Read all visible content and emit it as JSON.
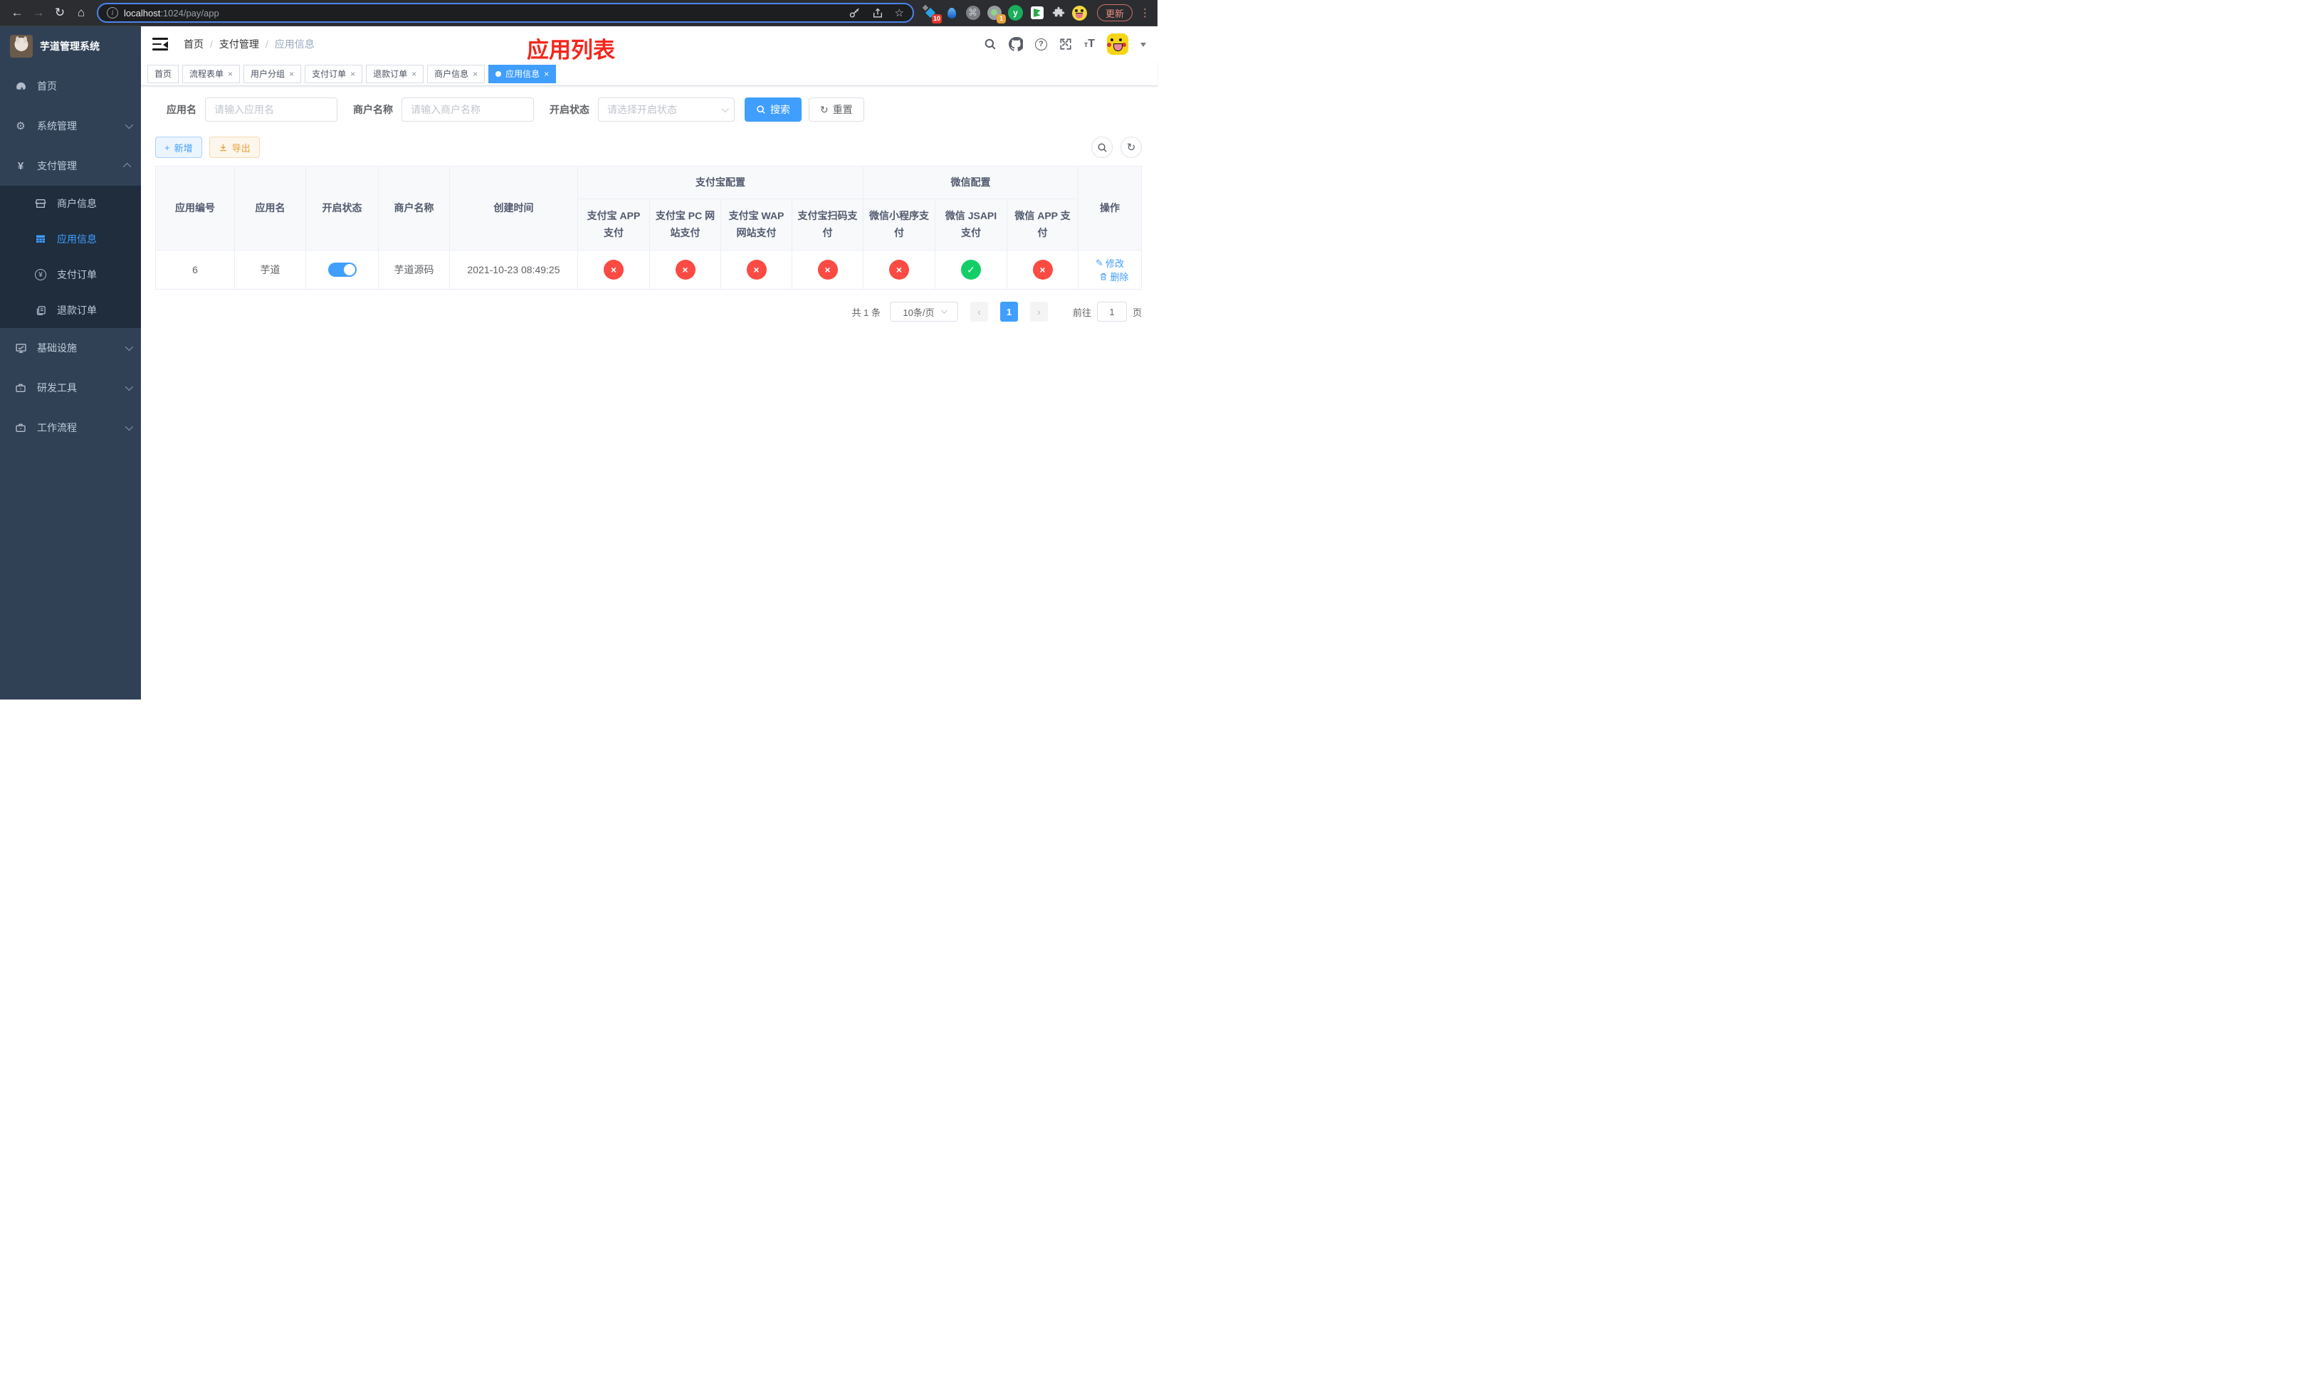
{
  "colors": {
    "accent": "#409eff",
    "danger": "#fb4b43",
    "success": "#13ce66",
    "warning": "#e6a23c",
    "annotation_red": "#f5261b",
    "sidebar_bg": "#304156",
    "submenu_bg": "#1f2d3d"
  },
  "icons": {
    "back": "←",
    "forward": "→",
    "reload": "↻",
    "home": "⌂",
    "star": "☆",
    "info": "i",
    "cmd": "⌘",
    "kebab": "⋮",
    "gear": "⚙",
    "yen": "¥",
    "plus": "+",
    "close": "×",
    "cross": "×",
    "check": "✓",
    "edit": "✎",
    "refresh": "↻",
    "prev": "‹",
    "next": "›",
    "question": "?",
    "ext_green_letter": "y",
    "font_small": "т",
    "font_big": "T"
  },
  "browser": {
    "url_host": "localhost",
    "url_rest": ":1024/pay/app",
    "update_label": "更新",
    "ext_badge_blue_diamond": "10",
    "ext_badge_camera": "1"
  },
  "sidebar": {
    "title": "芋道管理系统",
    "items": [
      {
        "label": "首页"
      },
      {
        "label": "系统管理"
      },
      {
        "label": "支付管理"
      },
      {
        "label": "商户信息"
      },
      {
        "label": "应用信息"
      },
      {
        "label": "支付订单"
      },
      {
        "label": "退款订单"
      },
      {
        "label": "基础设施"
      },
      {
        "label": "研发工具"
      },
      {
        "label": "工作流程"
      }
    ]
  },
  "navbar": {
    "breadcrumb": [
      "首页",
      "支付管理",
      "应用信息"
    ],
    "annotation": "应用列表"
  },
  "tabs": [
    {
      "label": "首页"
    },
    {
      "label": "流程表单"
    },
    {
      "label": "用户分组"
    },
    {
      "label": "支付订单"
    },
    {
      "label": "退款订单"
    },
    {
      "label": "商户信息"
    },
    {
      "label": "应用信息"
    }
  ],
  "filters": {
    "app_name_label": "应用名",
    "app_name_placeholder": "请输入应用名",
    "merchant_label": "商户名称",
    "merchant_placeholder": "请输入商户名称",
    "status_label": "开启状态",
    "status_placeholder": "请选择开启状态",
    "search_label": "搜索",
    "reset_label": "重置"
  },
  "toolbar": {
    "add_label": "新增",
    "export_label": "导出"
  },
  "table": {
    "headers": {
      "col_app_id": "应用编号",
      "col_app_name": "应用名",
      "col_status": "开启状态",
      "col_merchant": "商户名称",
      "col_created": "创建时间",
      "group_alipay": "支付宝配置",
      "group_wechat": "微信配置",
      "alipay_cols": [
        "支付宝 APP 支付",
        "支付宝 PC 网站支付",
        "支付宝 WAP 网站支付",
        "支付宝扫码支付"
      ],
      "wechat_cols": [
        "微信小程序支付",
        "微信 JSAPI 支付",
        "微信 APP 支付"
      ],
      "col_actions": "操作"
    },
    "row": {
      "id": "6",
      "name": "芋道",
      "enabled": true,
      "merchant": "芋道源码",
      "created": "2021-10-23 08:49:25",
      "statuses": [
        "x",
        "x",
        "x",
        "x",
        "x",
        "check",
        "x"
      ],
      "edit_label": "修改",
      "delete_label": "删除"
    }
  },
  "pagination": {
    "total": "共 1 条",
    "page_size": "10条/页",
    "current_page": "1",
    "goto_prefix": "前往",
    "goto_value": "1",
    "goto_suffix": "页"
  }
}
